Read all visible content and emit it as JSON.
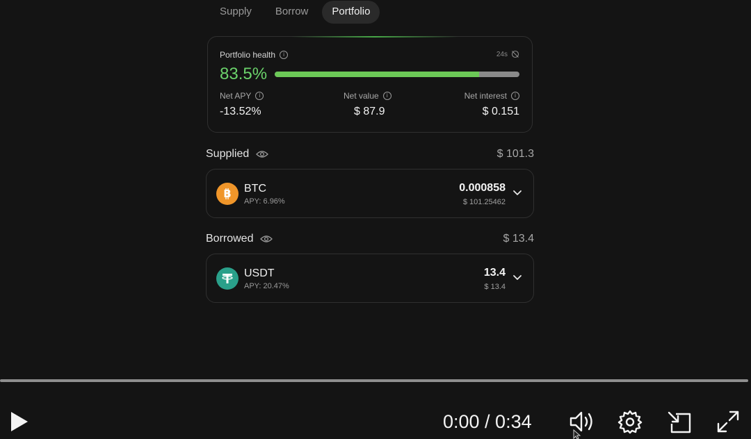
{
  "tabs": [
    {
      "label": "Supply",
      "active": false
    },
    {
      "label": "Borrow",
      "active": false
    },
    {
      "label": "Portfolio",
      "active": true
    }
  ],
  "health": {
    "label": "Portfolio health",
    "timer": "24s",
    "value": "83.5%",
    "percent": 83.5,
    "stats": [
      {
        "label": "Net APY",
        "value": "-13.52%"
      },
      {
        "label": "Net value",
        "value": "$ 87.9"
      },
      {
        "label": "Net interest",
        "value": "$ 0.151"
      }
    ]
  },
  "supplied": {
    "title": "Supplied",
    "total": "$ 101.3",
    "asset": {
      "symbol": "BTC",
      "apy": "APY: 6.96%",
      "amount": "0.000858",
      "usd": "$ 101.25462"
    }
  },
  "borrowed": {
    "title": "Borrowed",
    "total": "$ 13.4",
    "asset": {
      "symbol": "USDT",
      "apy": "APY: 20.47%",
      "amount": "13.4",
      "usd": "$ 13.4"
    }
  },
  "player": {
    "time": "0:00 / 0:34",
    "progress": 0
  },
  "colors": {
    "accent_green": "#6bd36b",
    "btc": "#f0962a",
    "usdt": "#2aa08a"
  }
}
